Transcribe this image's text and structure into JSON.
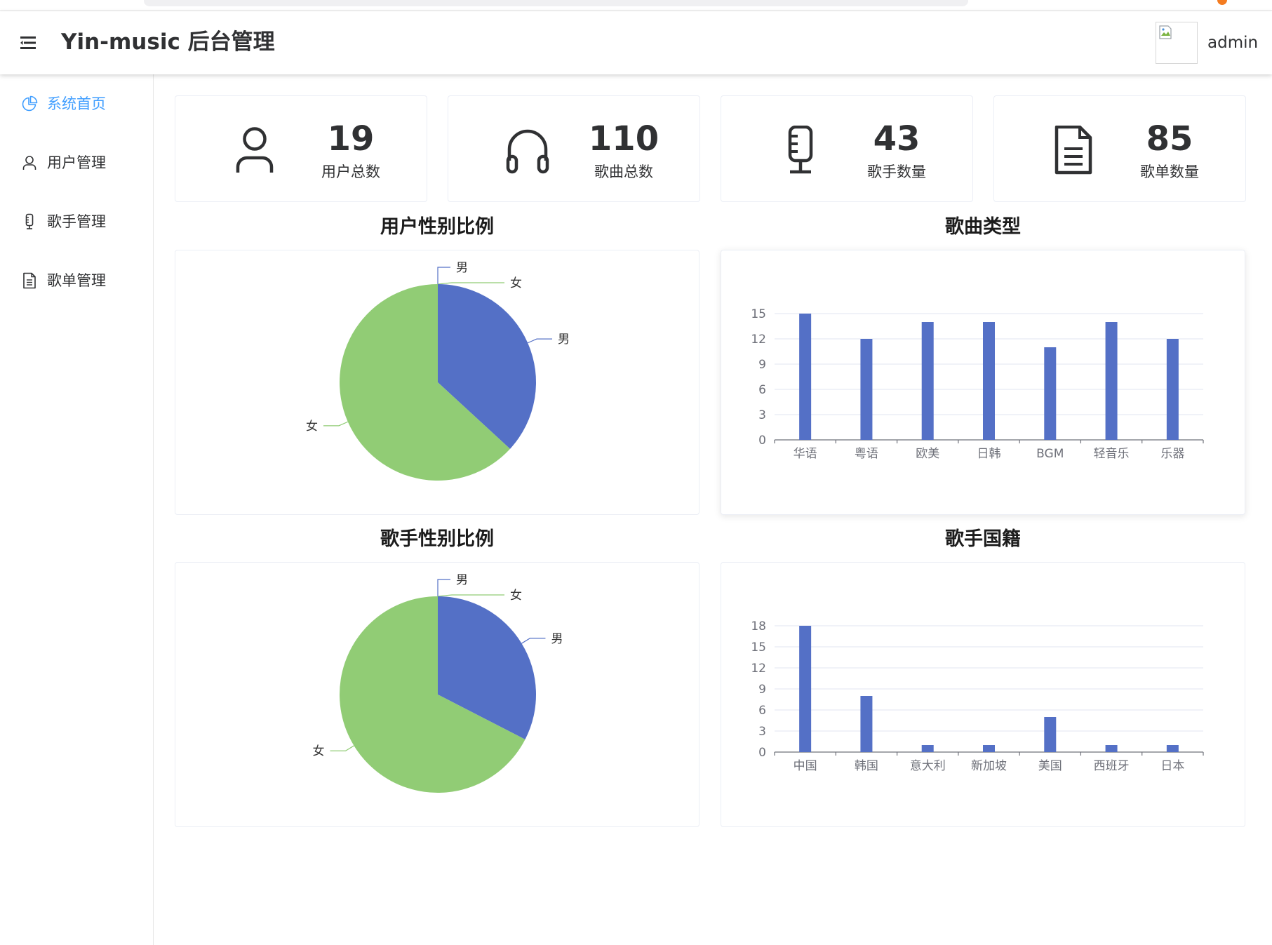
{
  "header": {
    "title": "Yin-music 后台管理",
    "username": "admin"
  },
  "sidebar": {
    "items": [
      {
        "label": "系统首页",
        "icon": "pie-chart-icon",
        "active": true
      },
      {
        "label": "用户管理",
        "icon": "user-icon",
        "active": false
      },
      {
        "label": "歌手管理",
        "icon": "microphone-icon",
        "active": false
      },
      {
        "label": "歌单管理",
        "icon": "document-icon",
        "active": false
      }
    ]
  },
  "stats": [
    {
      "value": "19",
      "label": "用户总数",
      "icon": "user-icon"
    },
    {
      "value": "110",
      "label": "歌曲总数",
      "icon": "headphones-icon"
    },
    {
      "value": "43",
      "label": "歌手数量",
      "icon": "microphone-icon"
    },
    {
      "value": "85",
      "label": "歌单数量",
      "icon": "document-icon"
    }
  ],
  "colors": {
    "accent": "#409eff",
    "blue": "#5470c6",
    "green": "#91cc75",
    "text": "#303133",
    "axis": "#6e7079"
  },
  "chart_data": [
    {
      "type": "pie",
      "title": "用户性别比例",
      "series": [
        {
          "slices": [
            {
              "label": "男",
              "value": 0
            },
            {
              "label": "女",
              "value": 0
            },
            {
              "label": "男",
              "value": 7
            },
            {
              "label": "女",
              "value": 12
            }
          ]
        }
      ]
    },
    {
      "type": "bar",
      "title": "歌曲类型",
      "categories": [
        "华语",
        "粤语",
        "欧美",
        "日韩",
        "BGM",
        "轻音乐",
        "乐器"
      ],
      "values": [
        15,
        12,
        14,
        14,
        11,
        14,
        12
      ],
      "yticks": [
        0,
        3,
        6,
        9,
        12,
        15
      ],
      "ylim": [
        0,
        15
      ],
      "grid": true
    },
    {
      "type": "pie",
      "title": "歌手性别比例",
      "series": [
        {
          "slices": [
            {
              "label": "男",
              "value": 0
            },
            {
              "label": "女",
              "value": 0
            },
            {
              "label": "男",
              "value": 14
            },
            {
              "label": "女",
              "value": 29
            }
          ]
        }
      ]
    },
    {
      "type": "bar",
      "title": "歌手国籍",
      "categories": [
        "中国",
        "韩国",
        "意大利",
        "新加坡",
        "美国",
        "西班牙",
        "日本"
      ],
      "values": [
        18,
        8,
        1,
        1,
        5,
        1,
        1
      ],
      "yticks": [
        0,
        3,
        6,
        9,
        12,
        15,
        18
      ],
      "ylim": [
        0,
        18
      ],
      "grid": true
    }
  ]
}
